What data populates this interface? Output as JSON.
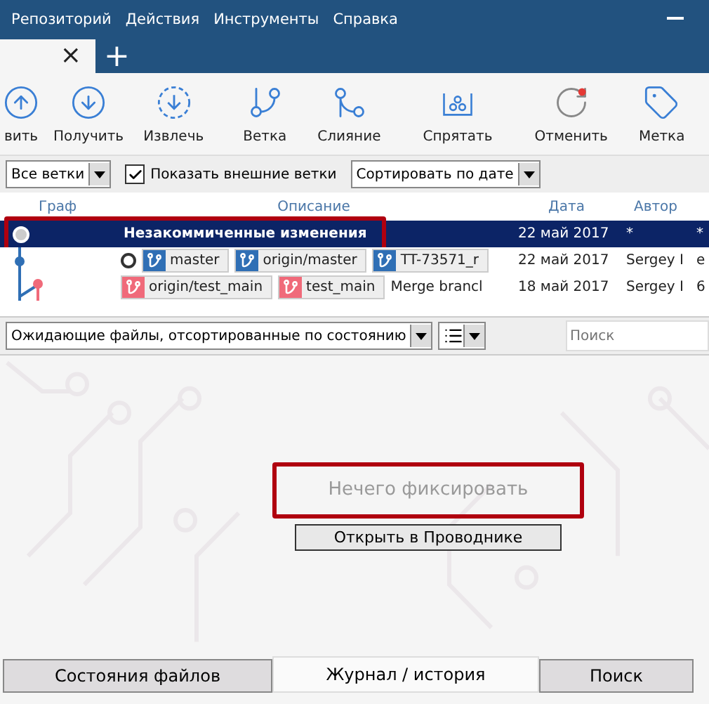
{
  "menu": [
    "Репозиторий",
    "Действия",
    "Инструменты",
    "Справка"
  ],
  "tab_strip": {
    "close": "×",
    "add": "+"
  },
  "toolbar": [
    {
      "label": "вить"
    },
    {
      "label": "Получить"
    },
    {
      "label": "Извлечь"
    },
    {
      "label": "Ветка"
    },
    {
      "label": "Слияние"
    },
    {
      "label": "Спрятать"
    },
    {
      "label": "Отменить"
    },
    {
      "label": "Метка"
    }
  ],
  "filter_bar": {
    "branches": "Все ветки",
    "show_remote": {
      "label": "Показать внешние ветки",
      "checked": true
    },
    "sort": "Сортировать по дате"
  },
  "table": {
    "columns": [
      "Граф",
      "Описание",
      "Дата",
      "Автор"
    ],
    "rows": [
      {
        "selected": true,
        "highlighted": true,
        "head": false,
        "tags": [],
        "description": "Незакоммиченные изменения",
        "date": "22 май 2017",
        "author": "*",
        "column_5": "*"
      },
      {
        "selected": false,
        "highlighted": false,
        "head": true,
        "tags": [
          {
            "label": "master",
            "color": "#2f6fb5"
          },
          {
            "label": "origin/master",
            "color": "#2f6fb5"
          },
          {
            "label": "TT-73571_r",
            "color": "#2f6fb5"
          }
        ],
        "description": "",
        "date": "22 май 2017",
        "author": "Sergey I",
        "column_5": "e"
      },
      {
        "selected": false,
        "highlighted": false,
        "head": false,
        "tags": [
          {
            "label": "origin/test_main",
            "color": "#f06a7a"
          },
          {
            "label": "test_main",
            "color": "#f06a7a"
          }
        ],
        "description": "Merge brancl",
        "date": "18 май 2017",
        "author": "Sergey I",
        "column_5": "6"
      }
    ]
  },
  "files_bar": {
    "filter": "Ожидающие файлы, отсортированные по состоянию",
    "search_placeholder": "Поиск"
  },
  "empty_state": {
    "message": "Нечего фиксировать",
    "highlighted": true,
    "button": "Открыть в Проводнике"
  },
  "bottom_tabs": [
    {
      "label": "Состояния файлов",
      "selected": false
    },
    {
      "label": "Журнал / история",
      "selected": true
    },
    {
      "label": "Поиск",
      "selected": false
    }
  ]
}
